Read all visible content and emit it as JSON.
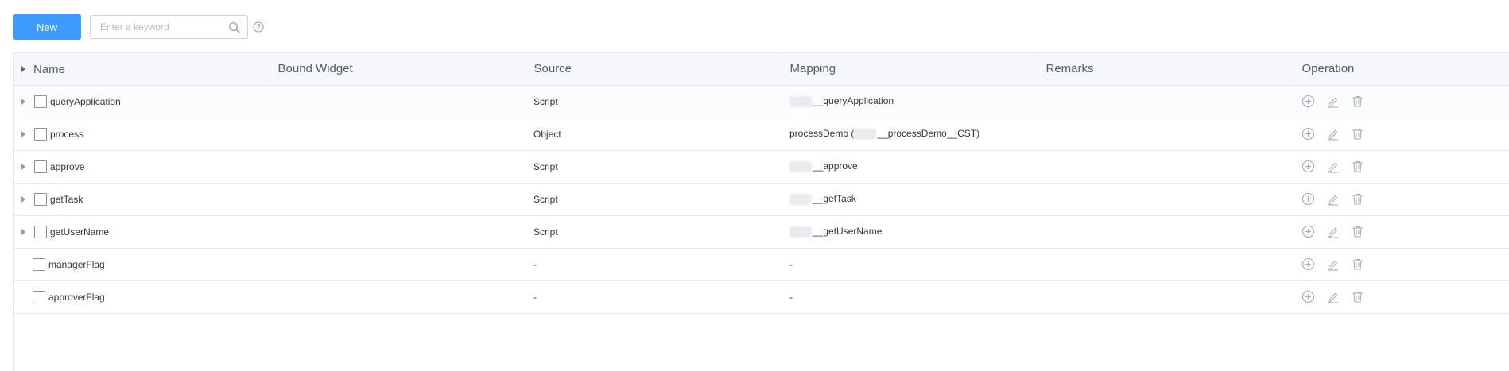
{
  "toolbar": {
    "new_label": "New",
    "search_placeholder": "Enter a keyword",
    "search_value": ""
  },
  "table": {
    "columns": [
      "Name",
      "Bound Widget",
      "Source",
      "Mapping",
      "Remarks",
      "Operation"
    ],
    "rows": [
      {
        "name": "queryApplication",
        "bound_widget": "",
        "source": "Script",
        "mapping_prefix": "",
        "mapping": "__queryApplication",
        "mapping_suffix": "",
        "remarks": "",
        "expandable": true
      },
      {
        "name": "process",
        "bound_widget": "",
        "source": "Object",
        "mapping_prefix": "processDemo (",
        "mapping": "__processDemo__CST)",
        "mapping_suffix": "",
        "remarks": "",
        "expandable": true
      },
      {
        "name": "approve",
        "bound_widget": "",
        "source": "Script",
        "mapping_prefix": "",
        "mapping": "__approve",
        "mapping_suffix": "",
        "remarks": "",
        "expandable": true
      },
      {
        "name": "getTask",
        "bound_widget": "",
        "source": "Script",
        "mapping_prefix": "",
        "mapping": "__getTask",
        "mapping_suffix": "",
        "remarks": "",
        "expandable": true
      },
      {
        "name": "getUserName",
        "bound_widget": "",
        "source": "Script",
        "mapping_prefix": "",
        "mapping": "__getUserName",
        "mapping_suffix": "",
        "remarks": "",
        "expandable": true
      },
      {
        "name": "managerFlag",
        "bound_widget": "",
        "source": "-",
        "mapping_prefix": "-",
        "mapping": "",
        "mapping_suffix": "",
        "remarks": "",
        "expandable": false
      },
      {
        "name": "approverFlag",
        "bound_widget": "",
        "source": "-",
        "mapping_prefix": "-",
        "mapping": "",
        "mapping_suffix": "",
        "remarks": "",
        "expandable": false
      }
    ]
  },
  "icons": {
    "search": "search-icon",
    "help": "help-icon",
    "add": "add-icon",
    "edit": "edit-icon",
    "delete": "trash-icon",
    "expand": "caret-right-icon"
  },
  "colors": {
    "primary": "#3d9bff",
    "header_bg": "#f5f7fa",
    "border": "#e4e7ec",
    "icon_gray": "#a7abb3"
  }
}
